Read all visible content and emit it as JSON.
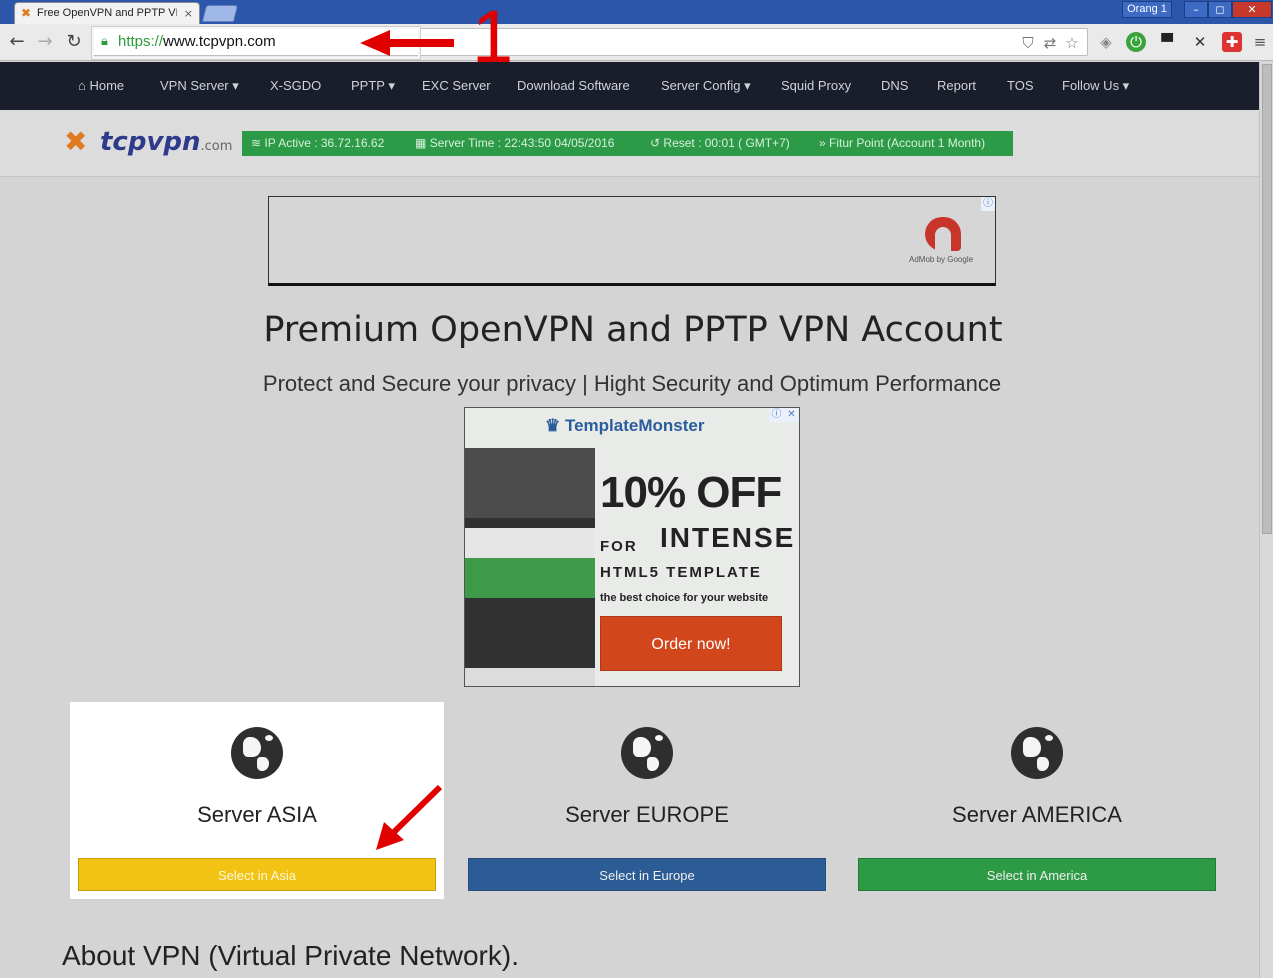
{
  "browser": {
    "tab_title": "Free OpenVPN and PPTP VPN",
    "tab_close": "×",
    "profile_label": "Orang 1",
    "url_scheme": "https://",
    "url_host": "www.tcpvpn.com",
    "window_controls": {
      "minimize": "–",
      "maximize": "◻",
      "close": "✕"
    }
  },
  "nav": {
    "items": [
      {
        "label": "Home",
        "icon": "home-icon"
      },
      {
        "label": "VPN Server ▾"
      },
      {
        "label": "X-SGDO"
      },
      {
        "label": "PPTP ▾"
      },
      {
        "label": "EXC Server"
      },
      {
        "label": "Download Software"
      },
      {
        "label": "Server Config ▾"
      },
      {
        "label": "Squid Proxy"
      },
      {
        "label": "DNS"
      },
      {
        "label": "Report"
      },
      {
        "label": "TOS"
      },
      {
        "label": "Follow Us ▾"
      }
    ]
  },
  "brand": {
    "logo_text": "tcpvpn",
    "logo_suffix": ".com"
  },
  "status": {
    "ip": "IP Active : 36.72.16.62",
    "server_time": "Server Time : 22:43:50 04/05/2016",
    "reset": "Reset : 00:01 ( GMT+7)",
    "feature": "Fitur Point (Account 1 Month)"
  },
  "ads": {
    "top_label": "AdMob by Google",
    "mid_brand": "TemplateMonster",
    "mid_headline": "10% OFF",
    "mid_for": "FOR",
    "mid_intense": "INTENSE",
    "mid_html5": "HTML5 TEMPLATE",
    "mid_tagline": "the best choice for your website",
    "mid_cta": "Order now!"
  },
  "hero": {
    "title": "Premium OpenVPN and PPTP VPN Account",
    "subtitle": "Protect and Secure your privacy | Hight Security and Optimum Performance"
  },
  "servers": [
    {
      "title": "Server ASIA",
      "button": "Select in Asia",
      "color": "#f2c314"
    },
    {
      "title": "Server EUROPE",
      "button": "Select in Europe",
      "color": "#2c5c96"
    },
    {
      "title": "Server AMERICA",
      "button": "Select in America",
      "color": "#2d9a45"
    }
  ],
  "about": {
    "heading": "About VPN (Virtual Private Network)."
  },
  "annotation": {
    "number": "1",
    "color": "#e00000"
  },
  "colors": {
    "nav_bg": "#1a1e2a",
    "status_green": "#2c9a46",
    "page_bg": "#d4d4d4",
    "browser_blue": "#2b56a9"
  }
}
